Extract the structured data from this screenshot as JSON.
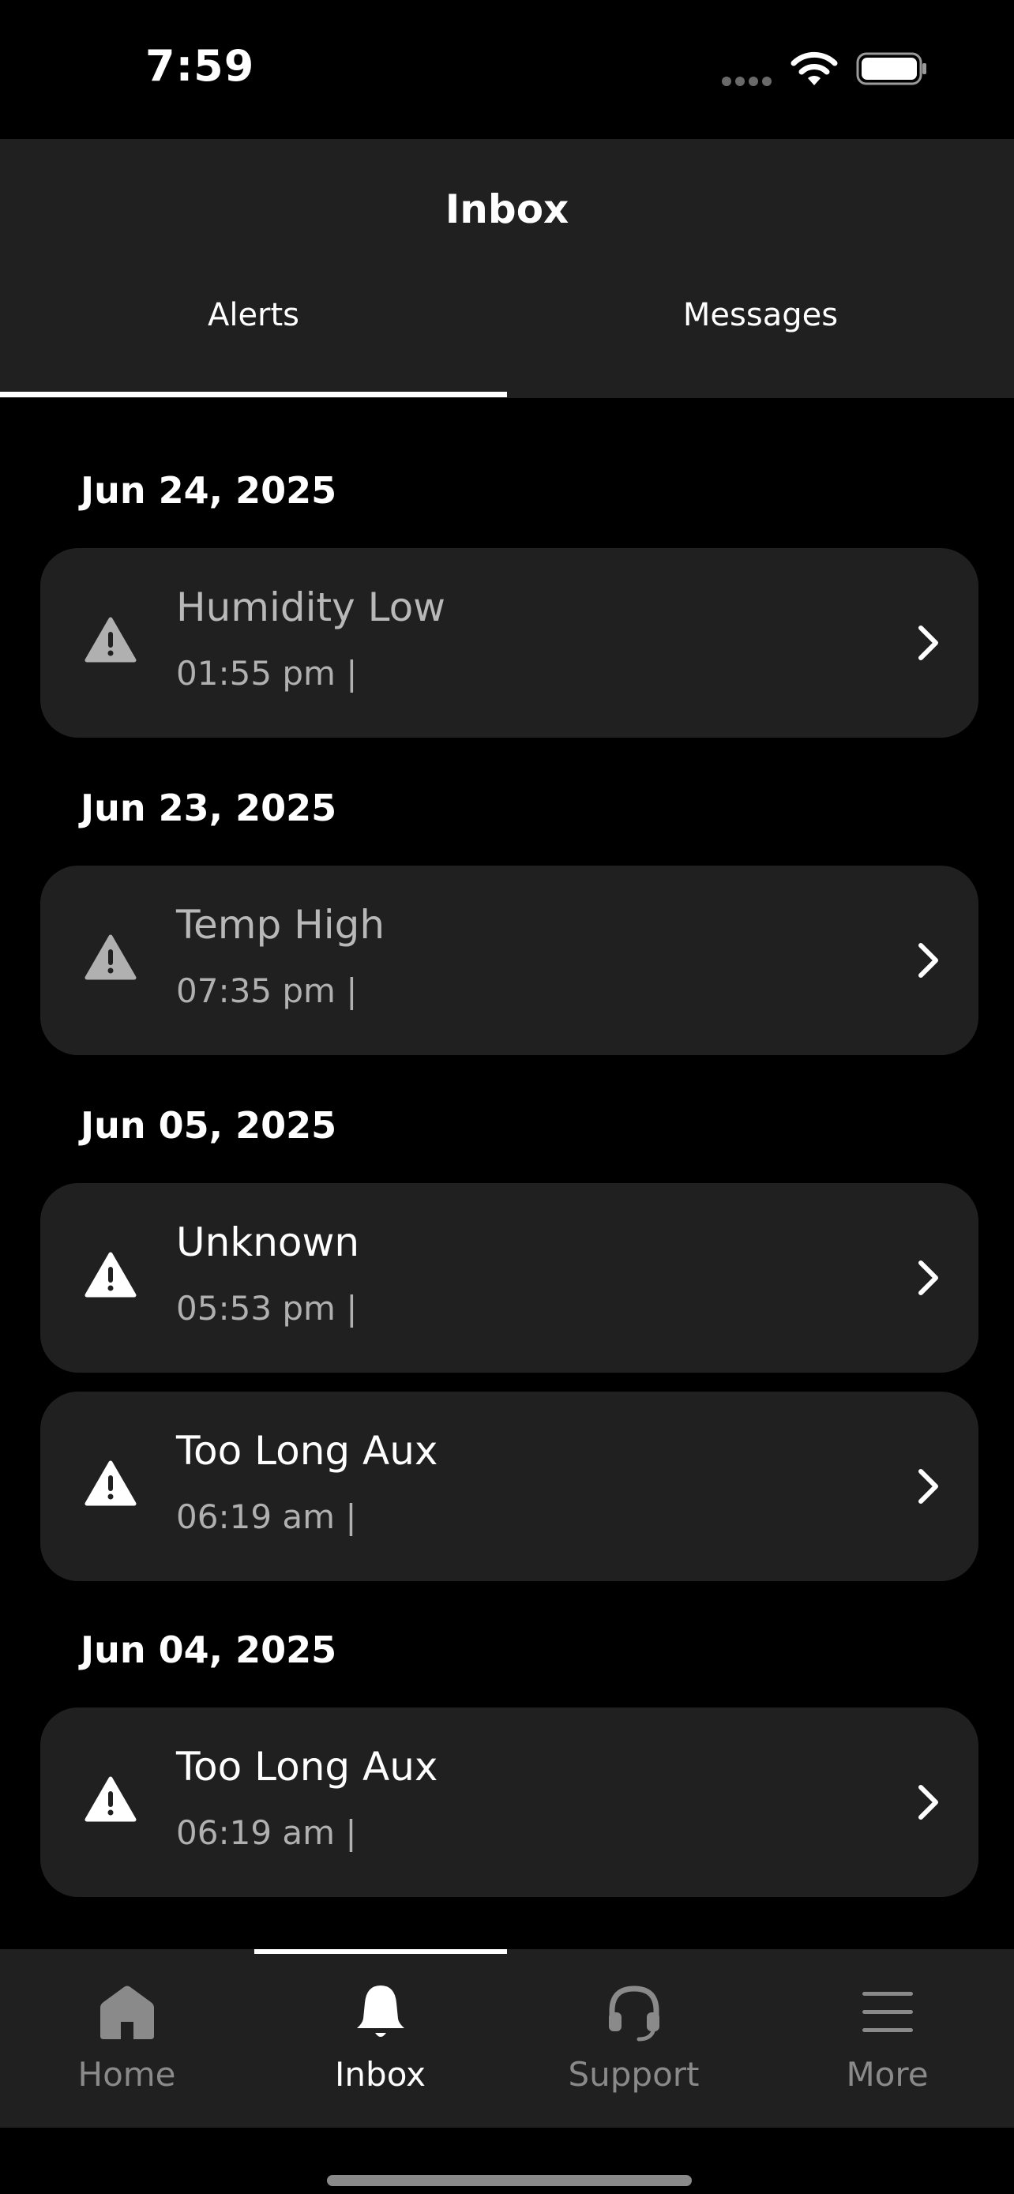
{
  "status_bar": {
    "time": "7:59"
  },
  "header": {
    "title": "Inbox",
    "tabs": [
      {
        "label": "Alerts",
        "selected": true
      },
      {
        "label": "Messages",
        "selected": false
      }
    ]
  },
  "alerts": {
    "groups": [
      {
        "date": "Jun 24, 2025",
        "items": [
          {
            "title": "Humidity Low",
            "time": "01:55 pm |",
            "read": true
          }
        ]
      },
      {
        "date": "Jun 23, 2025",
        "items": [
          {
            "title": "Temp High",
            "time": "07:35 pm |",
            "read": true
          }
        ]
      },
      {
        "date": "Jun 05, 2025",
        "items": [
          {
            "title": "Unknown",
            "time": "05:53 pm |",
            "read": false
          },
          {
            "title": "Too Long Aux",
            "time": "06:19 am |",
            "read": false
          }
        ]
      },
      {
        "date": "Jun 04, 2025",
        "items": [
          {
            "title": "Too Long Aux",
            "time": "06:19 am |",
            "read": false
          }
        ]
      }
    ]
  },
  "tab_bar": {
    "items": [
      {
        "label": "Home",
        "icon": "home-icon",
        "active": false
      },
      {
        "label": "Inbox",
        "icon": "bell-icon",
        "active": true
      },
      {
        "label": "Support",
        "icon": "headset-icon",
        "active": false
      },
      {
        "label": "More",
        "icon": "menu-icon",
        "active": false
      }
    ]
  },
  "colors": {
    "background": "#000000",
    "surface": "#202020",
    "accent": "#ffffff",
    "inactive": "#8a8a8a"
  }
}
